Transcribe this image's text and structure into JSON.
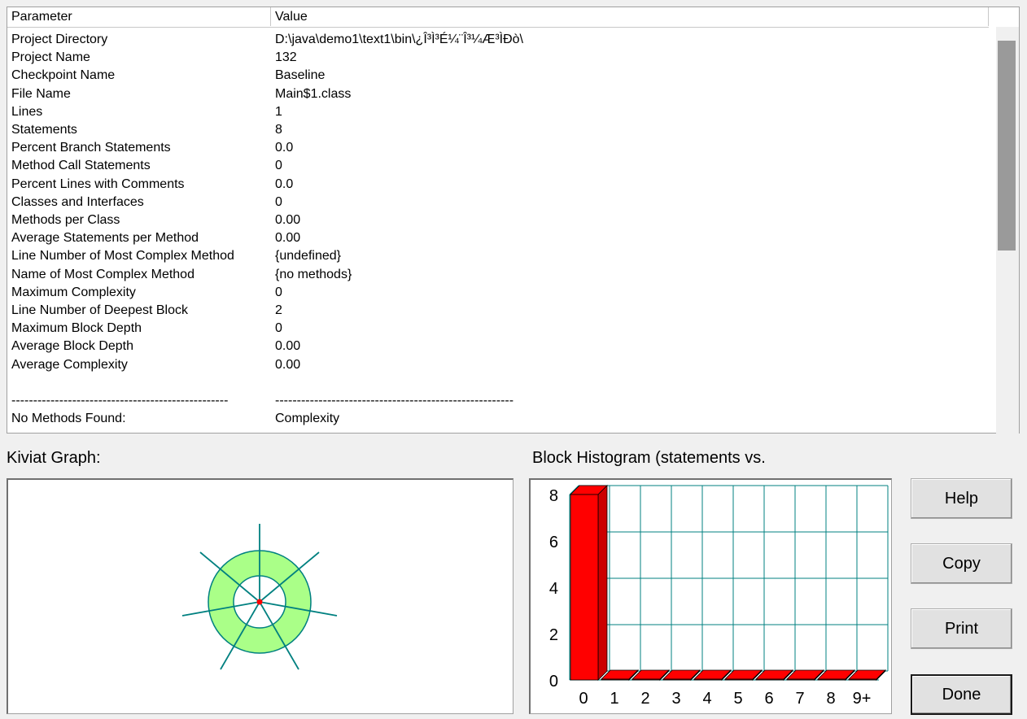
{
  "table": {
    "headers": {
      "parameter": "Parameter",
      "value": "Value"
    },
    "rows": [
      {
        "param": "Project Directory",
        "value": "D:\\java\\demo1\\text1\\bin\\¿Î³Ì³É¼¨Î³¼Æ³ÌÐò\\"
      },
      {
        "param": "Project Name",
        "value": "132"
      },
      {
        "param": "Checkpoint Name",
        "value": "Baseline"
      },
      {
        "param": "File Name",
        "value": "Main$1.class"
      },
      {
        "param": "Lines",
        "value": "1"
      },
      {
        "param": "Statements",
        "value": "8"
      },
      {
        "param": "Percent Branch Statements",
        "value": "0.0"
      },
      {
        "param": "Method Call Statements",
        "value": "0"
      },
      {
        "param": "Percent Lines with Comments",
        "value": "0.0"
      },
      {
        "param": "Classes and Interfaces",
        "value": "0"
      },
      {
        "param": "Methods per Class",
        "value": "0.00"
      },
      {
        "param": "Average Statements per Method",
        "value": "0.00"
      },
      {
        "param": "Line Number of Most Complex Method",
        "value": "{undefined}"
      },
      {
        "param": "Name of Most Complex Method",
        "value": "{no methods}"
      },
      {
        "param": "Maximum Complexity",
        "value": "0"
      },
      {
        "param": "Line Number of Deepest Block",
        "value": "2"
      },
      {
        "param": "Maximum Block Depth",
        "value": "0"
      },
      {
        "param": "Average Block Depth",
        "value": "0.00"
      },
      {
        "param": "Average Complexity",
        "value": "0.00"
      },
      {
        "param": "",
        "value": ""
      },
      {
        "param": "--------------------------------------------------",
        "value": "-------------------------------------------------------"
      },
      {
        "param": "No Methods Found:",
        "value": "Complexity"
      }
    ]
  },
  "kiviat": {
    "label": "Kiviat Graph:"
  },
  "histogram": {
    "label": "Block Histogram (statements vs.",
    "chart_data": {
      "type": "bar",
      "categories": [
        "0",
        "1",
        "2",
        "3",
        "4",
        "5",
        "6",
        "7",
        "8",
        "9+"
      ],
      "values": [
        8,
        0,
        0,
        0,
        0,
        0,
        0,
        0,
        0,
        0
      ],
      "yticks": [
        "0",
        "2",
        "4",
        "6",
        "8"
      ],
      "ylim": [
        0,
        8
      ],
      "bar_color": "#ff0000",
      "grid_color": "#008080"
    }
  },
  "buttons": {
    "help": "Help",
    "copy": "Copy",
    "print": "Print",
    "done": "Done"
  },
  "colors": {
    "kiviat_ring": "#aaff88",
    "kiviat_line": "#008080",
    "bar": "#ff0000"
  }
}
